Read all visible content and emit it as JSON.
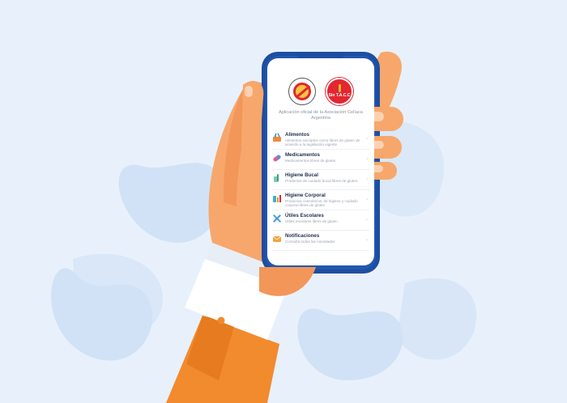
{
  "app": {
    "logos": [
      "acela-logo",
      "sin-tacc-logo"
    ],
    "logo_text": "Sin T.A.C.C",
    "subtitle": "Aplicación oficial de la Asociación Celíaca Argentina"
  },
  "menu": [
    {
      "title": "Alimentos",
      "desc": "Alimentos inscriptos como libres de gluten de acuerdo a la legislación vigente",
      "icon": "shopping-basket-icon"
    },
    {
      "title": "Medicamentos",
      "desc": "Medicamentos libres de gluten",
      "icon": "pill-icon"
    },
    {
      "title": "Higiene Bucal",
      "desc": "Productos de cuidado bucal libres de gluten",
      "icon": "toothbrush-icon"
    },
    {
      "title": "Higiene Corporal",
      "desc": "Productos cosméticos, de higiene y cuidado corporal libres de gluten",
      "icon": "cosmetics-icon"
    },
    {
      "title": "Útiles Escolares",
      "desc": "Útiles escolares libres de gluten",
      "icon": "school-supplies-icon"
    },
    {
      "title": "Notificaciones",
      "desc": "Consultá todas las novedades",
      "icon": "envelope-icon"
    }
  ],
  "colors": {
    "background": "#e8f1fb",
    "phone_frame": "#1e4ea1",
    "skin": "#f7a76b",
    "sleeve": "#f28a2e",
    "accent_red": "#e3262f"
  }
}
